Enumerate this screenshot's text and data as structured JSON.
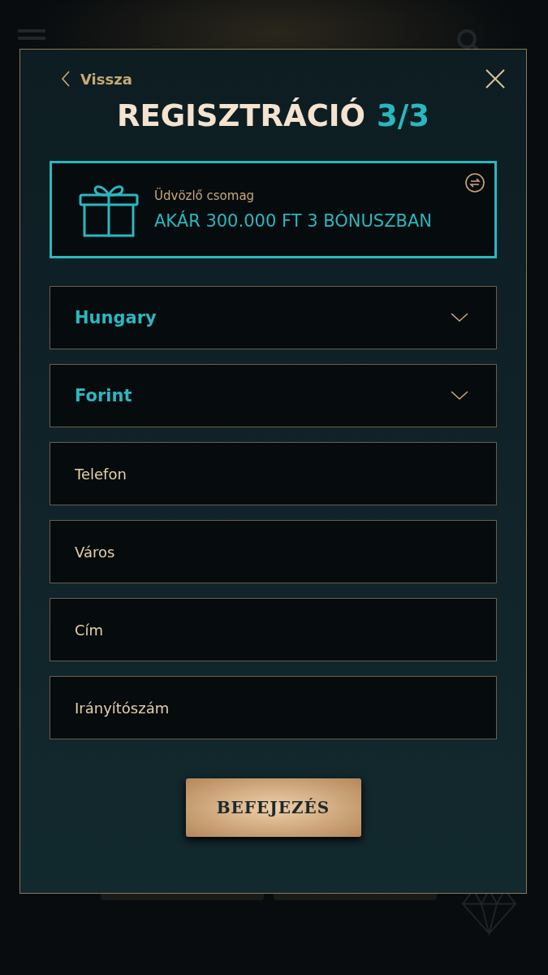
{
  "modal": {
    "back_label": "Vissza",
    "title": "REGISZTRÁCIÓ",
    "step": "3/3",
    "bonus": {
      "label": "Üdvözlő csomag",
      "offer": "AKÁR 300.000 FT 3 BÓNUSZBAN"
    },
    "fields": [
      {
        "kind": "select",
        "value": "Hungary"
      },
      {
        "kind": "select",
        "value": "Forint"
      },
      {
        "kind": "text",
        "placeholder": "Telefon"
      },
      {
        "kind": "text",
        "placeholder": "Város"
      },
      {
        "kind": "text",
        "placeholder": "Cím"
      },
      {
        "kind": "text",
        "placeholder": "Irányítószám"
      }
    ],
    "submit": "BEFEJEZÉS"
  }
}
